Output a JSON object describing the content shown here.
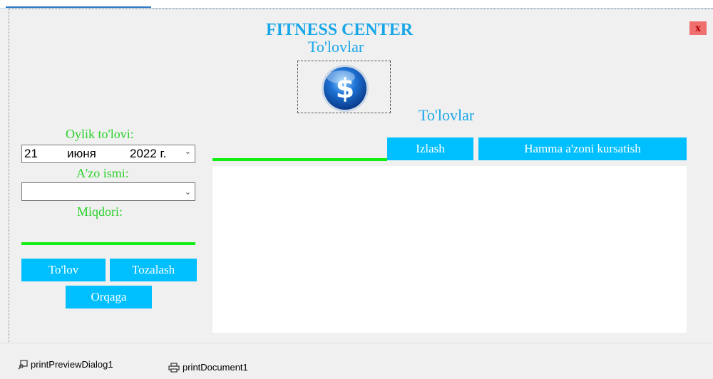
{
  "window": {
    "close_label": "x"
  },
  "header": {
    "title": "FITNESS CENTER",
    "subtitle": "To'lovlar",
    "logo_icon": "dollar-coin-icon"
  },
  "left_panel": {
    "oylik_label": "Oylik to'lovi:",
    "date": {
      "day": "21",
      "month": "июня",
      "year": "2022 г."
    },
    "azo_label": "A'zo ismi:",
    "azo_value": "",
    "miqdori_label": "Miqdori:",
    "miqdori_value": "",
    "buttons": {
      "tolov": "To'lov",
      "tozalash": "Tozalash",
      "orqaga": "Orqaga"
    }
  },
  "right_panel": {
    "section_title": "To'lovlar",
    "search_value": "",
    "buttons": {
      "izlash": "Izlash",
      "hamma": "Hamma a'zoni kursatish"
    }
  },
  "tray": {
    "items": [
      {
        "label": "printPreviewDialog1",
        "icon": "print-preview-icon"
      },
      {
        "label": "printDocument1",
        "icon": "printer-icon"
      }
    ]
  },
  "colors": {
    "accent": "#00bfff",
    "title": "#1aa7e8",
    "label_green": "#2bd12b",
    "underline_green": "#11ee11",
    "close_bg": "#f07070"
  }
}
